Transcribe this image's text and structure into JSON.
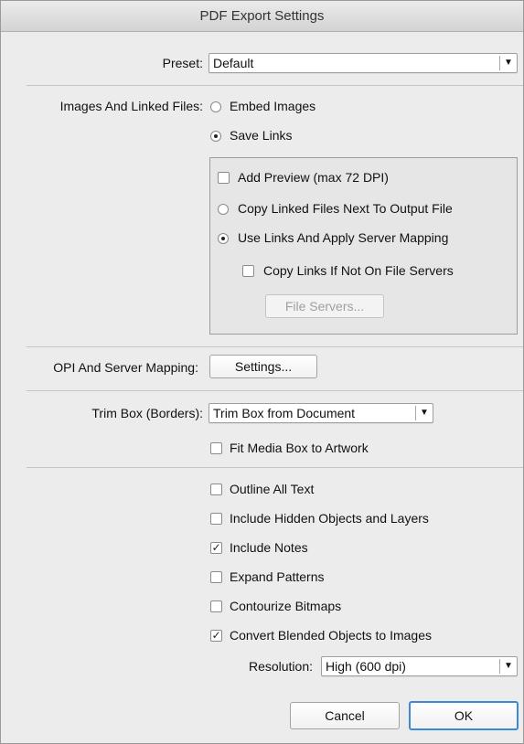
{
  "window": {
    "title": "PDF Export Settings"
  },
  "preset": {
    "label": "Preset:",
    "value": "Default"
  },
  "images": {
    "label": "Images And Linked Files:",
    "embed_label": "Embed Images",
    "save_links_label": "Save Links",
    "add_preview_label": "Add Preview (max 72 DPI)",
    "copy_linked_label": "Copy Linked Files Next To Output File",
    "use_links_label": "Use Links And Apply Server Mapping",
    "copy_if_not_label": "Copy Links If Not On File Servers",
    "file_servers_label": "File Servers..."
  },
  "opi": {
    "label": "OPI And Server Mapping:",
    "settings_label": "Settings..."
  },
  "trim": {
    "label": "Trim Box (Borders):",
    "value": "Trim Box from Document",
    "fit_media_label": "Fit Media Box to Artwork"
  },
  "options": {
    "outline_text": {
      "label": "Outline All Text",
      "checked": false
    },
    "include_hidden": {
      "label": "Include Hidden Objects and Layers",
      "checked": false
    },
    "include_notes": {
      "label": "Include Notes",
      "checked": true
    },
    "expand_patterns": {
      "label": "Expand Patterns",
      "checked": false
    },
    "contourize": {
      "label": "Contourize Bitmaps",
      "checked": false
    },
    "convert_blended": {
      "label": "Convert Blended Objects to Images",
      "checked": true
    }
  },
  "resolution": {
    "label": "Resolution:",
    "value": "High (600 dpi)"
  },
  "footer": {
    "cancel_label": "Cancel",
    "ok_label": "OK"
  },
  "icons": {
    "dropdown": "chevron-down-icon",
    "check": "checkmark-icon"
  }
}
